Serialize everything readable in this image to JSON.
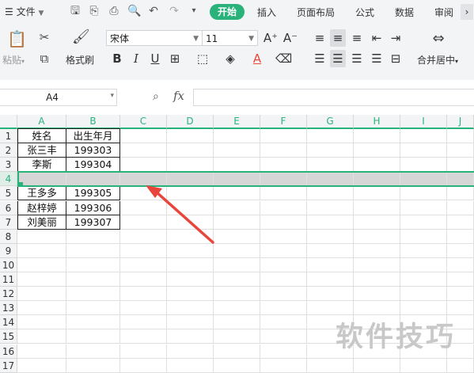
{
  "menu": {
    "file_label": "文件",
    "tabs": [
      "开始",
      "插入",
      "页面布局",
      "公式",
      "数据",
      "审阅"
    ]
  },
  "ribbon": {
    "paste_label": "粘贴",
    "format_painter_label": "格式刷",
    "font_name": "宋体",
    "font_size": "11",
    "merge_center_label": "合并居中",
    "bold": "B",
    "italic": "I",
    "underline": "U",
    "font_color_letter": "A",
    "grow_font": "A⁺",
    "shrink_font": "A⁻"
  },
  "formula": {
    "name_box": "A4",
    "fx_label": "fx",
    "value": ""
  },
  "sheet": {
    "columns": [
      "A",
      "B",
      "C",
      "D",
      "E",
      "F",
      "G",
      "H",
      "I",
      "J"
    ],
    "rows": [
      "1",
      "2",
      "3",
      "4",
      "5",
      "6",
      "7",
      "8",
      "9",
      "10",
      "11",
      "12",
      "13",
      "14",
      "15",
      "16",
      "17"
    ],
    "cells": {
      "A1": "姓名",
      "B1": "出生年月",
      "A2": "张三丰",
      "B2": "199303",
      "A3": "李斯",
      "B3": "199304",
      "A5": "王多多",
      "B5": "199305",
      "A6": "赵梓婷",
      "B6": "199306",
      "A7": "刘美丽",
      "B7": "199307"
    },
    "selected_row": "4"
  },
  "watermark": "软件技巧",
  "colors": {
    "accent": "#2ab27b",
    "arrow": "#e8453c"
  }
}
